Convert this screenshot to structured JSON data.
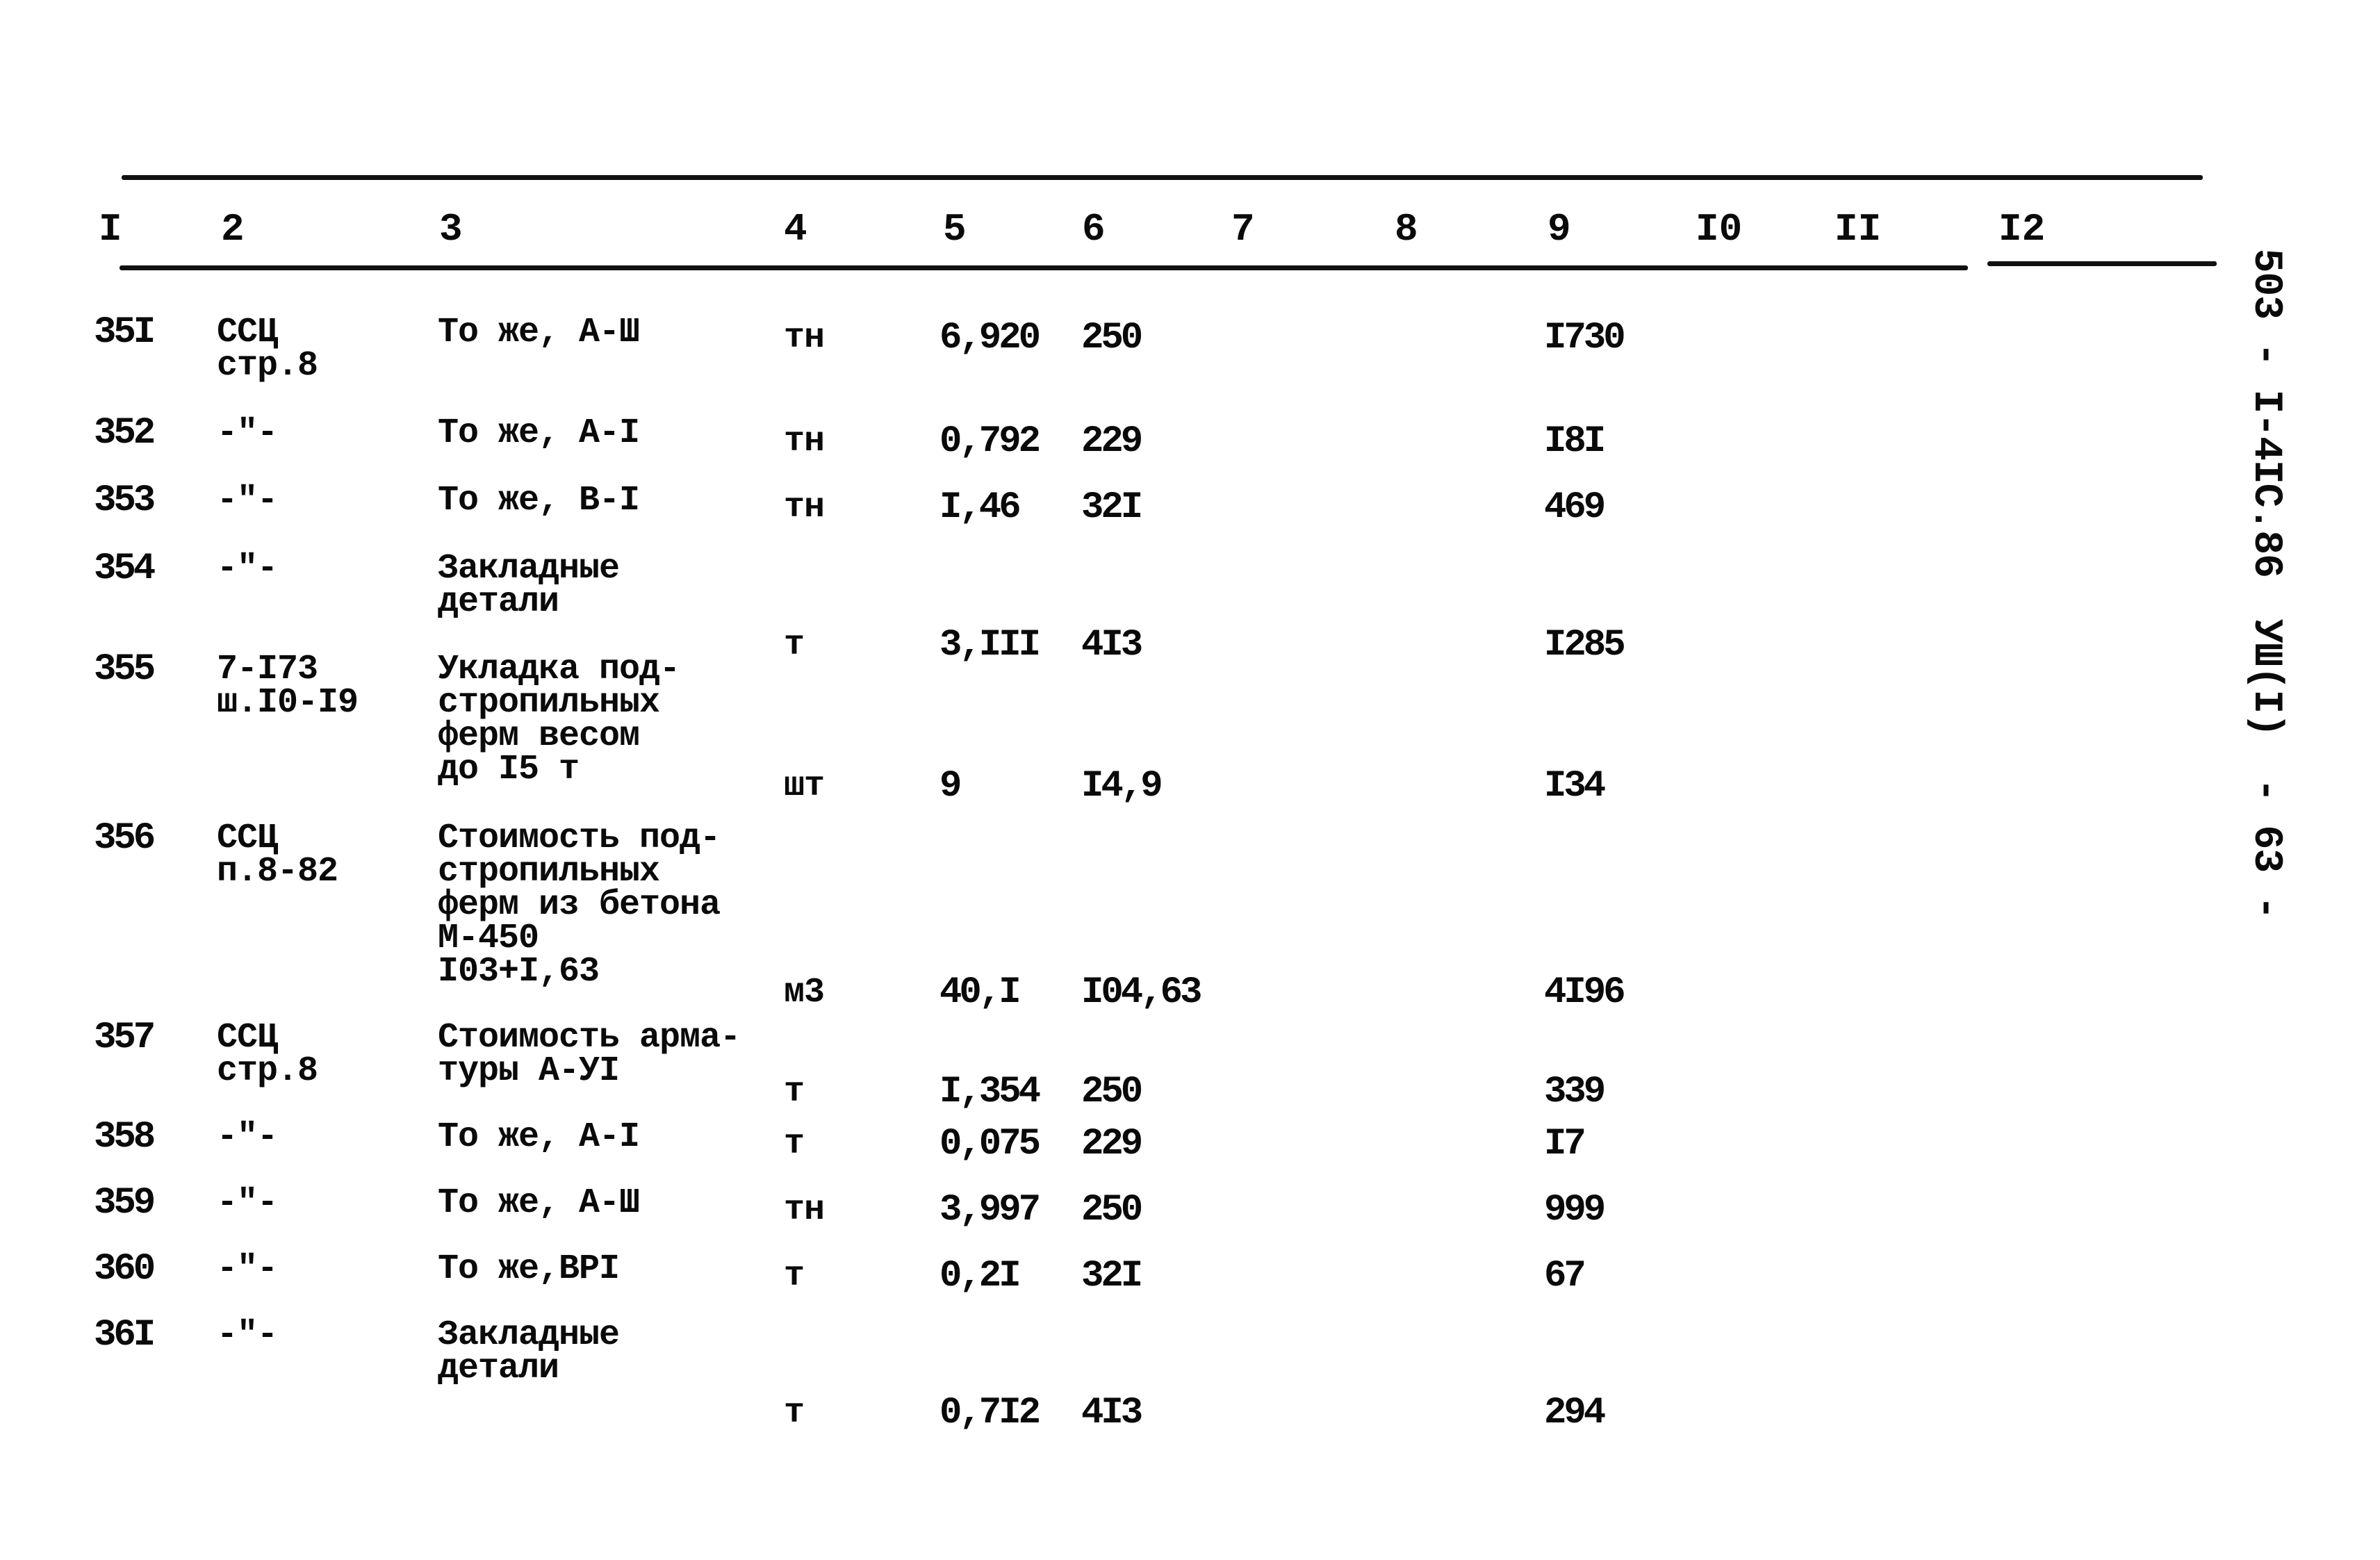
{
  "side_label": {
    "code": "503 - I-4IC.86",
    "volume": "УШ(I)",
    "page": "- 63 -"
  },
  "table": {
    "column_headers": [
      "I",
      "2",
      "3",
      "4",
      "5",
      "6",
      "7",
      "8",
      "9",
      "I0",
      "II",
      "I2"
    ],
    "rows": [
      {
        "c1": "35I",
        "c2": "ССЦ\nстр.8",
        "c3": "То же, А-Ш",
        "c4": "тн",
        "c5": "6,920",
        "c6": "250",
        "c9": "I730"
      },
      {
        "c1": "352",
        "c2": "-\"-",
        "c3": "То же, А-I",
        "c4": "тн",
        "c5": "0,792",
        "c6": "229",
        "c9": "I8I"
      },
      {
        "c1": "353",
        "c2": "-\"-",
        "c3": "То же, В-I",
        "c4": "тн",
        "c5": "I,46",
        "c6": "32I",
        "c9": "469"
      },
      {
        "c1": "354",
        "c2": "-\"-",
        "c3": "Закладные\nдетали",
        "c4": "т",
        "c5": "3,III",
        "c6": "4I3",
        "c9": "I285"
      },
      {
        "c1": "355",
        "c2": "7-I73\nш.I0-I9",
        "c3": "Укладка под-\nстропильных\nферм весом\nдо I5 т",
        "c4": "шт",
        "c5": "9",
        "c6": "I4,9",
        "c9": "I34"
      },
      {
        "c1": "356",
        "c2": "ССЦ\nп.8-82",
        "c3": "Стоимость под-\nстропильных\nферм из бетона\nМ-450\nI03+I,63",
        "c4": "м3",
        "c5": "40,I",
        "c6": "I04,63",
        "c9": "4I96"
      },
      {
        "c1": "357",
        "c2": "ССЦ\nстр.8",
        "c3": "Стоимость арма-\nтуры А-УI",
        "c4": "т",
        "c5": "I,354",
        "c6": "250",
        "c9": "339"
      },
      {
        "c1": "358",
        "c2": "-\"-",
        "c3": "То же, А-I",
        "c4": "т",
        "c5": "0,075",
        "c6": "229",
        "c9": "I7"
      },
      {
        "c1": "359",
        "c2": "-\"-",
        "c3": "То же, А-Ш",
        "c4": "тн",
        "c5": "3,997",
        "c6": "250",
        "c9": "999"
      },
      {
        "c1": "360",
        "c2": "-\"-",
        "c3": "То же,ВРI",
        "c4": "т",
        "c5": "0,2I",
        "c6": "32I",
        "c9": "67"
      },
      {
        "c1": "36I",
        "c2": "-\"-",
        "c3": "Закладные\nдетали",
        "c4": "т",
        "c5": "0,7I2",
        "c6": "4I3",
        "c9": "294"
      }
    ]
  }
}
